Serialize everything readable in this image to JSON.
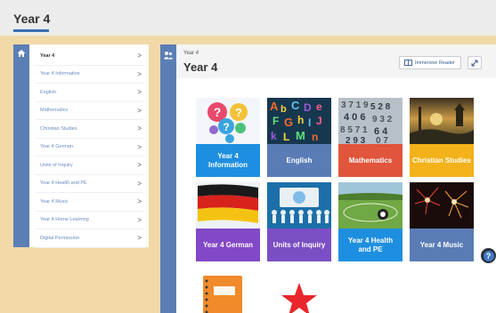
{
  "header": {
    "title": "Year 4"
  },
  "sidebar": {
    "items": [
      {
        "label": "Year 4",
        "active": true
      },
      {
        "label": "Year 4 Information"
      },
      {
        "label": "English"
      },
      {
        "label": "Mathematics"
      },
      {
        "label": "Christian Studies"
      },
      {
        "label": "Year 4 German"
      },
      {
        "label": "Units of Inquiry"
      },
      {
        "label": "Year 4 Health and PE"
      },
      {
        "label": "Year 4 Music"
      },
      {
        "label": "Year 4 Home Learning"
      },
      {
        "label": "Digital Permission"
      }
    ],
    "chevron": ">"
  },
  "main": {
    "breadcrumb": "Year 4",
    "title": "Year 4",
    "immersive_reader_label": "Immersive Reader",
    "tiles": [
      {
        "label": "Year 4 Information",
        "color": "#1e8fe0"
      },
      {
        "label": "English",
        "color": "#5a7cb6"
      },
      {
        "label": "Mathematics",
        "color": "#e0553b"
      },
      {
        "label": "Christian Studies",
        "color": "#f3b21a"
      },
      {
        "label": "Year 4 German",
        "color": "#8348c8"
      },
      {
        "label": "Units of Inquiry",
        "color": "#7b4fc4"
      },
      {
        "label": "Year 4 Health and PE",
        "color": "#1e8fe0"
      },
      {
        "label": "Year 4 Music",
        "color": "#5a7cb6"
      },
      {
        "label": "",
        "color": "#ffffff"
      },
      {
        "label": "",
        "color": "#ffffff"
      }
    ]
  },
  "icons": [
    "home-icon",
    "people-icon",
    "immersive-reader-icon",
    "expand-icon",
    "help-icon"
  ],
  "help": {
    "glyph": "?"
  }
}
